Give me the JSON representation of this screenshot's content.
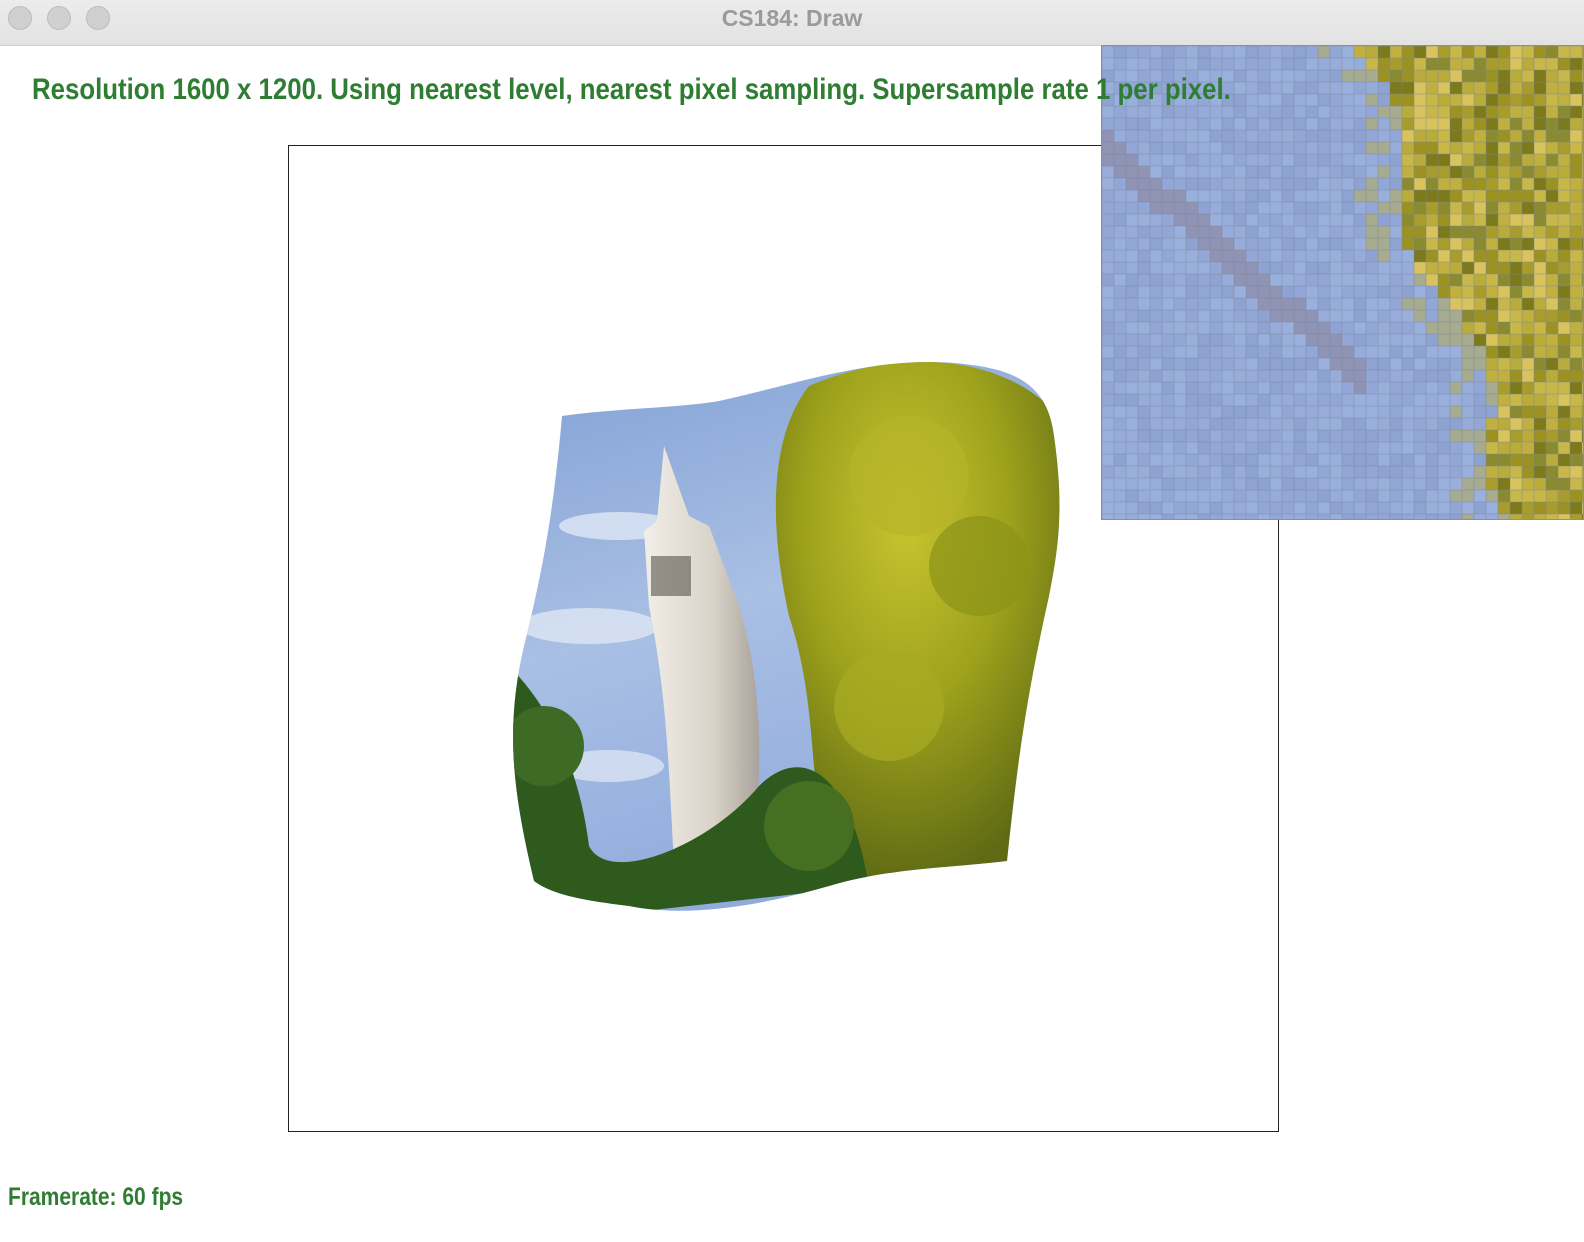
{
  "window": {
    "title": "CS184: Draw",
    "buttons": [
      "close",
      "minimize",
      "zoom"
    ]
  },
  "overlay": {
    "status_text": "Resolution 1600 x 1200. Using nearest level, nearest pixel sampling. Supersample rate 1 per pixel.",
    "framerate_text": "Framerate: 60 fps"
  },
  "colors": {
    "status_green": "#2e7d32",
    "sky": "#8ea7d6",
    "foliage": "#9aa51c",
    "tower": "#dcd6cc"
  },
  "scene": {
    "description_icon": "campanile-tower-image"
  }
}
